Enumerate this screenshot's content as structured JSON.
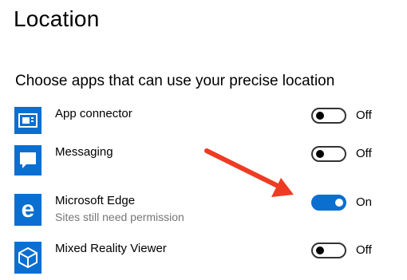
{
  "page": {
    "title": "Location"
  },
  "section": {
    "heading": "Choose apps that can use your precise location"
  },
  "apps": [
    {
      "name": "App connector",
      "subtitle": "",
      "icon": "app-connector-icon",
      "state": "Off",
      "on": false
    },
    {
      "name": "Messaging",
      "subtitle": "",
      "icon": "messaging-icon",
      "state": "Off",
      "on": false
    },
    {
      "name": "Microsoft Edge",
      "subtitle": "Sites still need permission",
      "icon": "edge-icon",
      "state": "On",
      "on": true
    },
    {
      "name": "Mixed Reality Viewer",
      "subtitle": "",
      "icon": "mixed-reality-viewer-icon",
      "state": "Off",
      "on": false
    }
  ],
  "colors": {
    "accent": "#0a6fd1",
    "annotation_arrow": "#ee3b23",
    "subtitle": "#767676"
  }
}
